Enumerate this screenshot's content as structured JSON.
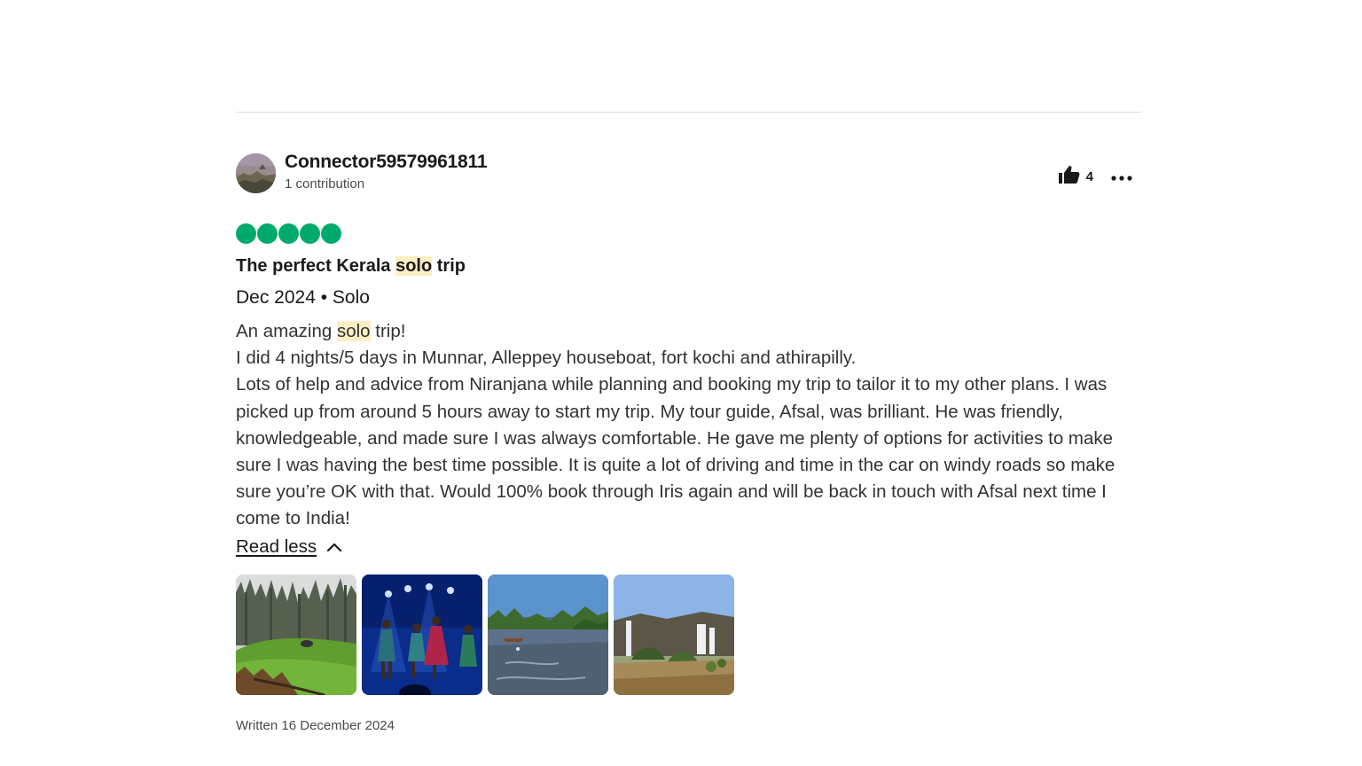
{
  "review": {
    "user": {
      "name": "Connector59579961811",
      "contributions": "1 contribution"
    },
    "helpful_count": "4",
    "rating": 5,
    "rating_color": "#00aa6c",
    "title_parts": {
      "before": "The perfect Kerala ",
      "highlight": "solo",
      "after": " trip"
    },
    "date_type": "Dec 2024 • Solo",
    "body": {
      "line1_before": "An amazing ",
      "line1_highlight": "solo",
      "line1_after": " trip!",
      "line2": "I did 4 nights/5 days in Munnar, Alleppey houseboat, fort kochi and athirapilly.",
      "line3": "Lots of help and advice from Niranjana while planning and booking my trip to tailor it to my other plans. I was picked up from around 5 hours away to start my trip. My tour guide, Afsal, was brilliant. He was friendly, knowledgeable, and made sure I was always comfortable. He gave me plenty of options for activities to make sure I was having the best time possible. It is quite a lot of driving and time in the car on windy roads so make sure you’re OK with that. Would 100% book through Iris again and will be back in touch with Afsal next time I come to India!"
    },
    "read_less_label": "Read less",
    "photos": [
      "tea-hills-photo",
      "dance-performance-photo",
      "backwater-photo",
      "waterfall-photo"
    ],
    "written_date": "Written 16 December 2024",
    "highlight_color": "#fcefc4"
  },
  "icons": {
    "thumb": "thumbs-up-icon",
    "more": "more-options-icon",
    "chevron": "chevron-up-icon"
  }
}
